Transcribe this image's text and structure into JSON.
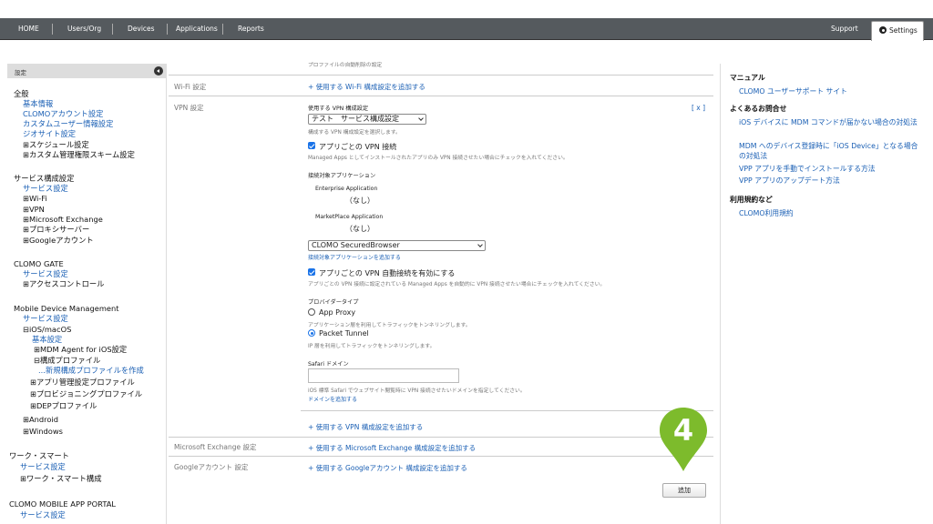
{
  "topnav": {
    "items": [
      "HOME",
      "Users/Org",
      "Devices",
      "Applications",
      "Reports"
    ],
    "support": "Support",
    "settings": "Settings"
  },
  "sidebar": {
    "header": "設定",
    "lines": [
      {
        "text": "全般",
        "kind": "h"
      },
      {
        "text": "基本情報",
        "kind": "l"
      },
      {
        "text": "CLOMOアカウント設定",
        "kind": "l"
      },
      {
        "text": "カスタムユーザー情報設定",
        "kind": "l"
      },
      {
        "text": "ジオサイト設定",
        "kind": "l"
      },
      {
        "text": "⊞スケジュール設定",
        "kind": "d"
      },
      {
        "text": "⊞カスタム管理権限スキーム設定",
        "kind": "d"
      },
      {
        "text": "サービス構成設定",
        "kind": "h"
      },
      {
        "text": "サービス設定",
        "kind": "l"
      },
      {
        "text": "⊞Wi-Fi",
        "kind": "d"
      },
      {
        "text": "⊞VPN",
        "kind": "d"
      },
      {
        "text": "⊞Microsoft Exchange",
        "kind": "d"
      },
      {
        "text": "⊞プロキシサーバー",
        "kind": "d"
      },
      {
        "text": "⊞Googleアカウント",
        "kind": "d"
      },
      {
        "text": "CLOMO GATE",
        "kind": "h"
      },
      {
        "text": "サービス設定",
        "kind": "l"
      },
      {
        "text": "⊞アクセスコントロール",
        "kind": "d"
      },
      {
        "text": "Mobile Device Management",
        "kind": "h"
      },
      {
        "text": "サービス設定",
        "kind": "l"
      },
      {
        "text": "⊟iOS/macOS",
        "kind": "d"
      },
      {
        "text": "基本設定",
        "kind": "l"
      },
      {
        "text": "⊞MDM Agent for iOS設定",
        "kind": "d"
      },
      {
        "text": "⊟構成プロファイル",
        "kind": "d"
      },
      {
        "text": "...新規構成プロファイルを作成",
        "kind": "l"
      },
      {
        "text": "⊞アプリ管理設定プロファイル",
        "kind": "d"
      },
      {
        "text": "⊞プロビジョニングプロファイル",
        "kind": "d"
      },
      {
        "text": "⊞DEPプロファイル",
        "kind": "d"
      },
      {
        "text": "⊞Android",
        "kind": "d"
      },
      {
        "text": "⊞Windows",
        "kind": "d"
      },
      {
        "text": "ワーク・スマート",
        "kind": "h"
      },
      {
        "text": "サービス設定",
        "kind": "l"
      },
      {
        "text": "⊞ワーク・スマート構成",
        "kind": "d"
      },
      {
        "text": "CLOMO MOBILE APP PORTAL",
        "kind": "h"
      },
      {
        "text": "サービス設定",
        "kind": "l"
      }
    ]
  },
  "main": {
    "top_cut_text": "プロファイルの自動削除の設定",
    "wifi_label": "Wi-Fi 設定",
    "wifi_add_link": "+ 使用する Wi-Fi 構成設定を追加する",
    "vpn_label": "VPN 設定",
    "vpn_close": "[ x ]",
    "vpn_config_heading": "使用する VPN 構成設定",
    "vpn_config_value": "テスト　サービス構成設定",
    "vpn_config_help": "構成する VPN 構成設定を選択します。",
    "per_app_vpn_label": "アプリごとの VPN 接続",
    "per_app_vpn_help": "Managed Apps としてインストールされたアプリのみ VPN 接続させたい場合にチェックを入れてください。",
    "target_apps_heading": "接続対象アプリケーション",
    "enterprise_heading": "Enterprise Application",
    "enterprise_value": "（なし）",
    "marketplace_heading": "MarketPlace Application",
    "marketplace_value": "（なし）",
    "app_select_value": "CLOMO SecuredBrowser",
    "add_target_app_link": "接続対象アプリケーションを追加する",
    "auto_vpn_label": "アプリごとの VPN 自動接続を有効にする",
    "auto_vpn_help": "アプリごとの VPN 接続に設定されている Managed Apps を自動的に VPN 接続させたい場合にチェックを入れてください。",
    "provider_heading": "プロバイダータイプ",
    "app_proxy_label": "App Proxy",
    "app_proxy_help": "アプリケーション層を利用してトラフィックをトンネリングします。",
    "packet_tunnel_label": "Packet Tunnel",
    "packet_tunnel_help": "IP 層を利用してトラフィックをトンネリングします。",
    "safari_heading": "Safari ドメイン",
    "safari_value": "",
    "safari_help": "iOS 標準 Safari でウェブサイト閲覧時に VPN 接続させたいドメインを指定してください。",
    "add_domain_link": "ドメインを追加する",
    "add_vpn_link": "+ 使用する VPN 構成設定を追加する",
    "exchange_label": "Microsoft Exchange 設定",
    "exchange_add_link": "+ 使用する Microsoft Exchange 構成設定を追加する",
    "google_label": "Googleアカウント 設定",
    "google_add_link": "+ 使用する Googleアカウント 構成設定を追加する",
    "add_button": "追加"
  },
  "step_marker": {
    "number": "4",
    "color": "#7dbb2c"
  },
  "right": {
    "lines": [
      {
        "text": "マニュアル",
        "kind": "h"
      },
      {
        "text": "CLOMO ユーザーサポート サイト",
        "kind": "l"
      },
      {
        "text": "よくあるお問合せ",
        "kind": "h"
      },
      {
        "text": "iOS デバイスに MDM コマンドが届かない場合の対処法",
        "kind": "l"
      },
      {
        "text": "MDM へのデバイス登録時に「iOS Device」となる場合の対処法",
        "kind": "l"
      },
      {
        "text": "VPP アプリを手動でインストールする方法",
        "kind": "l"
      },
      {
        "text": "VPP アプリのアップデート方法",
        "kind": "l"
      },
      {
        "text": "利用規約など",
        "kind": "h"
      },
      {
        "text": "CLOMO利用規約",
        "kind": "l"
      }
    ]
  },
  "colors": {
    "link": "#1a5fb4",
    "nav_bg": "#555a5e",
    "check": "#1a73e8"
  }
}
